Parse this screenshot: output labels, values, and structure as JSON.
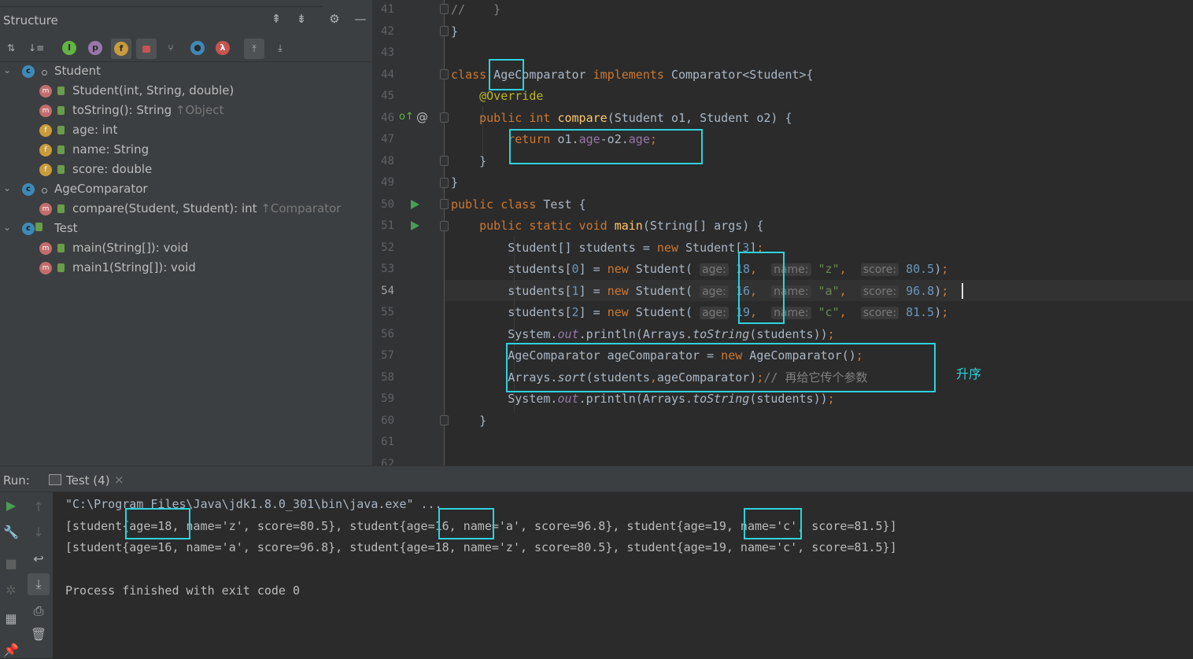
{
  "structure": {
    "title": "Structure",
    "toolbar_icons": [
      "sort-alpha-icon",
      "sort-visibility-icon",
      "inherited-icon",
      "properties-icon",
      "fields-icon",
      "non-public-icon",
      "anonymous-classes-icon",
      "lambdas-icon",
      "lambda-icon",
      "autoscroll-to-source-icon",
      "autoscroll-from-source-icon"
    ],
    "tree": [
      {
        "level": 0,
        "kind": "class",
        "expanded": true,
        "label": "Student",
        "suffix": ""
      },
      {
        "level": 1,
        "kind": "method",
        "label": "Student(int, String, double)",
        "suffix": ""
      },
      {
        "level": 1,
        "kind": "method",
        "label": "toString(): String",
        "suffix": "↑Object"
      },
      {
        "level": 1,
        "kind": "field",
        "label": "age: int",
        "suffix": ""
      },
      {
        "level": 1,
        "kind": "field",
        "label": "name: String",
        "suffix": ""
      },
      {
        "level": 1,
        "kind": "field",
        "label": "score: double",
        "suffix": ""
      },
      {
        "level": 0,
        "kind": "class",
        "expanded": true,
        "label": "AgeComparator",
        "suffix": ""
      },
      {
        "level": 1,
        "kind": "method",
        "label": "compare(Student, Student): int",
        "suffix": "↑Comparator"
      },
      {
        "level": 0,
        "kind": "class",
        "expanded": true,
        "label": "Test",
        "suffix": ""
      },
      {
        "level": 1,
        "kind": "method",
        "label": "main(String[]): void",
        "suffix": ""
      },
      {
        "level": 1,
        "kind": "method",
        "label": "main1(String[]): void",
        "suffix": ""
      }
    ]
  },
  "editor": {
    "current_line": 54,
    "lines": [
      {
        "n": "41",
        "html": "<span class='cmt'>//    }</span>"
      },
      {
        "n": "42",
        "html": "}"
      },
      {
        "n": "43",
        "html": ""
      },
      {
        "n": "44",
        "html": "<span class='kw'>class</span> AgeComparator <span class='kw'>implements</span> Comparator&lt;Student&gt;{"
      },
      {
        "n": "45",
        "html": "    <span class='ann'>@Override</span>"
      },
      {
        "n": "46",
        "html": "    <span class='kw'>public int</span> <span class='fn'>compare</span>(Student o1, Student o2) {"
      },
      {
        "n": "47",
        "html": "        <span class='kw'>return</span> o1.<span class='fld'>age</span>-o2.<span class='fld'>age</span><span class='kw'>;</span>"
      },
      {
        "n": "48",
        "html": "    }"
      },
      {
        "n": "49",
        "html": "}"
      },
      {
        "n": "50",
        "html": "<span class='kw'>public class</span> Test {"
      },
      {
        "n": "51",
        "html": "    <span class='kw'>public static void</span> <span class='fn'>main</span>(String[] args) {"
      },
      {
        "n": "52",
        "html": "        Student[] students = <span class='kw'>new</span> Student[<span class='num'>3</span>]<span class='kw'>;</span>"
      },
      {
        "n": "53",
        "html": "        students[<span class='num'>0</span>] = <span class='kw'>new</span> Student( <span class='hint'>age:</span> <span class='num'>18</span><span class='kw'>,</span>  <span class='hint'>name:</span> <span class='str'>\"z\"</span><span class='kw'>,</span>  <span class='hint'>score:</span> <span class='num'>80.5</span>)<span class='kw'>;</span>"
      },
      {
        "n": "54",
        "html": "        students[<span class='num'>1</span>] = <span class='kw'>new</span> Student( <span class='hint'>age:</span> <span class='num'>16</span><span class='kw'>,</span>  <span class='hint'>name:</span> <span class='str'>\"a\"</span><span class='kw'>,</span>  <span class='hint'>score:</span> <span class='num'>96.8</span>)<span class='kw'>;</span>"
      },
      {
        "n": "55",
        "html": "        students[<span class='num'>2</span>] = <span class='kw'>new</span> Student( <span class='hint'>age:</span> <span class='num'>19</span><span class='kw'>,</span>  <span class='hint'>name:</span> <span class='str'>\"c\"</span><span class='kw'>,</span>  <span class='hint'>score:</span> <span class='num'>81.5</span>)<span class='kw'>;</span>"
      },
      {
        "n": "56",
        "html": "        System.<span class='fldi'>out</span>.println(Arrays.<span class='itl'>toString</span>(students))<span class='kw'>;</span>"
      },
      {
        "n": "57",
        "html": "        AgeComparator ageComparator = <span class='kw'>new</span> AgeComparator()<span class='kw'>;</span>"
      },
      {
        "n": "58",
        "html": "        Arrays.<span class='itl'>sort</span>(students<span class='kw'>,</span>ageComparator)<span class='kw'>;</span><span class='cmt'>// </span><span class='cn-cmt'>再给它传个参数</span>"
      },
      {
        "n": "59",
        "html": "        System.<span class='fldi'>out</span>.println(Arrays.<span class='itl'>toString</span>(students))<span class='kw'>;</span>"
      },
      {
        "n": "60",
        "html": "    }"
      },
      {
        "n": "61",
        "html": ""
      },
      {
        "n": "62",
        "html": ""
      }
    ],
    "annotation_label": "升序"
  },
  "run": {
    "label": "Run:",
    "tab_title": "Test (4)",
    "output": [
      {
        "text": "\"C:\\Program Files\\Java\\jdk1.8.0_301\\bin\\java.exe\" ...",
        "cmd": true
      },
      {
        "text": "[student{age=18, name='z', score=80.5}, student{age=16, name='a', score=96.8}, student{age=19, name='c', score=81.5}]",
        "cmd": false
      },
      {
        "text": "[student{age=16, name='a', score=96.8}, student{age=18, name='z', score=80.5}, student{age=19, name='c', score=81.5}]",
        "cmd": false
      },
      {
        "text": "",
        "cmd": false
      },
      {
        "text": "Process finished with exit code 0",
        "cmd": false
      }
    ]
  },
  "colors": {
    "highlight_box": "#2ed2dc",
    "keyword": "#cc7832",
    "method": "#ffc66d",
    "field": "#9876aa",
    "number": "#6897bb",
    "string": "#6a8759"
  }
}
